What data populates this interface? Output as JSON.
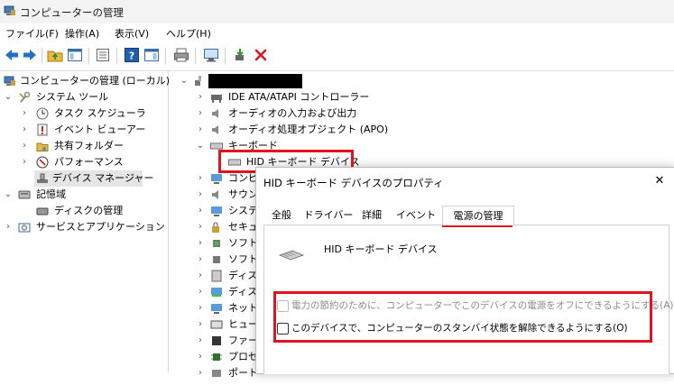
{
  "window": {
    "title": "コンピューターの管理"
  },
  "menu": [
    "ファイル(F)",
    "操作(A)",
    "表示(V)",
    "ヘルプ(H)"
  ],
  "left_tree": {
    "root": "コンピューターの管理 (ローカル)",
    "system_tools": "システム ツール",
    "task_scheduler": "タスク スケジューラ",
    "event_viewer": "イベント ビューアー",
    "shared_folders": "共有フォルダー",
    "performance": "パフォーマンス",
    "device_manager": "デバイス マネージャー",
    "storage": "記憶域",
    "disk_management": "ディスクの管理",
    "services_apps": "サービスとアプリケーション"
  },
  "device_tree": {
    "ide": "IDE ATA/ATAPI コントローラー",
    "audio_io": "オーディオの入力および出力",
    "apo": "オーディオ処理オブジェクト (APO)",
    "keyboard": "キーボード",
    "hid_keyboard": "HID キーボード デバイス",
    "partial": [
      "コンピ",
      "サウン",
      "システ",
      "セキュ",
      "ソフトウ",
      "ソフトウ",
      "ディスク",
      "ディス",
      "ネット",
      "ヒューマ",
      "ファーム",
      "プロセ",
      "ポート"
    ]
  },
  "dialog": {
    "title": "HID キーボード デバイスのプロパティ",
    "close": "✕",
    "tabs": [
      "全般",
      "ドライバー",
      "詳細",
      "イベント",
      "電源の管理"
    ],
    "device_name": "HID キーボード デバイス",
    "option1": "電力の節約のために、コンピューターでこのデバイスの電源をオフにできるようにする(A)",
    "option2": "このデバイスで、コンピューターのスタンバイ状態を解除できるようにする(O)"
  },
  "colors": {
    "highlight": "#e0141e",
    "selection": "#e5e5e5",
    "accent": "#0067c0"
  }
}
